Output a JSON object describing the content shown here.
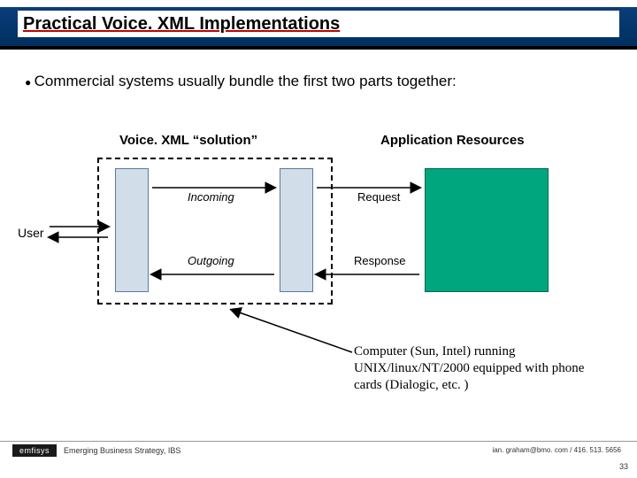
{
  "header": {
    "title": "Practical Voice. XML Implementations"
  },
  "bullet": "Commercial systems usually bundle the first two parts together:",
  "labels": {
    "solution": "Voice. XML “solution”",
    "appResources": "Application Resources",
    "incoming": "Incoming",
    "outgoing": "Outgoing",
    "request": "Request",
    "response": "Response",
    "user": "User"
  },
  "caption": "Computer (Sun, Intel) running UNIX/linux/NT/2000 equipped with phone cards (Dialogic, etc. )",
  "footer": {
    "logo": "emfisys",
    "left": "Emerging Business Strategy, IBS",
    "right": "ian. graham@bmo. com / 416. 513. 5656",
    "slide": "33"
  }
}
